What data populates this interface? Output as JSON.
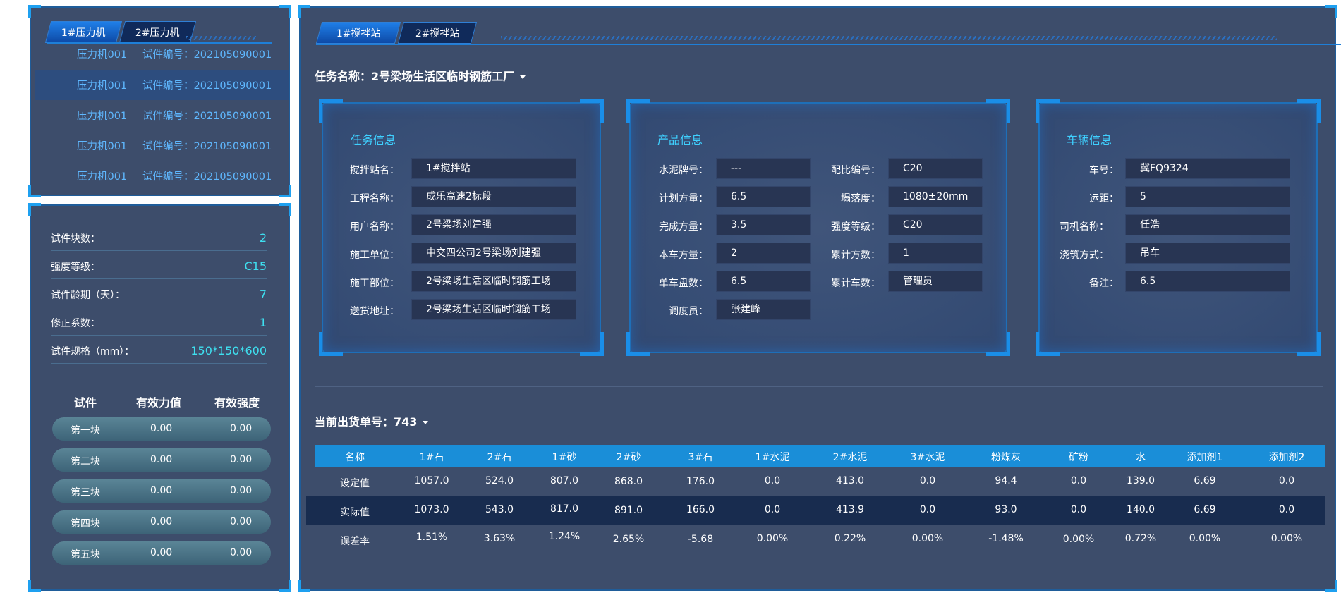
{
  "left_top": {
    "tabs": [
      "1#压力机",
      "2#压力机"
    ],
    "rows": [
      {
        "name": "压力机001",
        "code": "试件编号：202105090001"
      },
      {
        "name": "压力机001",
        "code": "试件编号：202105090001"
      },
      {
        "name": "压力机001",
        "code": "试件编号：202105090001"
      },
      {
        "name": "压力机001",
        "code": "试件编号：202105090001"
      },
      {
        "name": "压力机001",
        "code": "试件编号：202105090001"
      }
    ]
  },
  "left_bottom": {
    "stats": [
      {
        "label": "试件块数：",
        "value": "2"
      },
      {
        "label": "强度等级：",
        "value": "C15"
      },
      {
        "label": "试件龄期（天）：",
        "value": "7"
      },
      {
        "label": "修正系数：",
        "value": "1"
      },
      {
        "label": "试件规格（mm）：",
        "value": "150*150*600"
      }
    ],
    "table_headers": [
      "试件",
      "有效力值",
      "有效强度"
    ],
    "blocks": [
      {
        "name": "第一块",
        "force": "0.00",
        "strength": "0.00"
      },
      {
        "name": "第二块",
        "force": "0.00",
        "strength": "0.00"
      },
      {
        "name": "第三块",
        "force": "0.00",
        "strength": "0.00"
      },
      {
        "name": "第四块",
        "force": "0.00",
        "strength": "0.00"
      },
      {
        "name": "第五块",
        "force": "0.00",
        "strength": "0.00"
      }
    ]
  },
  "right": {
    "tabs": [
      "1#搅拌站",
      "2#搅拌站"
    ],
    "task_name": "任务名称：2号梁场生活区临时钢筋工厂",
    "task_info": {
      "title": "任务信息",
      "fields": [
        {
          "label": "搅拌站名：",
          "value": "1#搅拌站"
        },
        {
          "label": "工程名称：",
          "value": "成乐高速2标段"
        },
        {
          "label": "用户名称：",
          "value": "2号梁场刘建强"
        },
        {
          "label": "施工单位：",
          "value": "中交四公司2号梁场刘建强"
        },
        {
          "label": "施工部位：",
          "value": "2号梁场生活区临时钢筋工场"
        },
        {
          "label": "送货地址：",
          "value": "2号梁场生活区临时钢筋工场"
        }
      ]
    },
    "product_info": {
      "title": "产品信息",
      "left_fields": [
        {
          "label": "水泥牌号：",
          "value": "---"
        },
        {
          "label": "计划方量：",
          "value": "6.5"
        },
        {
          "label": "完成方量：",
          "value": "3.5"
        },
        {
          "label": "本车方量：",
          "value": "2"
        },
        {
          "label": "单车盘数：",
          "value": "6.5"
        },
        {
          "label": "调度员：",
          "value": "张建峰"
        }
      ],
      "right_fields": [
        {
          "label": "配比编号：",
          "value": "C20"
        },
        {
          "label": "塌落度：",
          "value": "1080±20mm"
        },
        {
          "label": "强度等级：",
          "value": "C20"
        },
        {
          "label": "累计方数：",
          "value": "1"
        },
        {
          "label": "累计车数：",
          "value": "管理员"
        }
      ]
    },
    "vehicle_info": {
      "title": "车辆信息",
      "fields": [
        {
          "label": "车号：",
          "value": "冀FQ9324"
        },
        {
          "label": "运距：",
          "value": "5"
        },
        {
          "label": "司机名称：",
          "value": "任浩"
        },
        {
          "label": "浇筑方式：",
          "value": "吊车"
        },
        {
          "label": "备注：",
          "value": "6.5"
        }
      ]
    },
    "shipment_no": "当前出货单号：743",
    "table": {
      "headers": [
        "名称",
        "1#石",
        "2#石",
        "1#砂",
        "2#砂",
        "3#石",
        "1#水泥",
        "2#水泥",
        "3#水泥",
        "粉煤灰",
        "矿粉",
        "水",
        "添加剂1",
        "添加剂2"
      ],
      "rows": [
        [
          "设定值",
          "1057.0",
          "524.0",
          "807.0",
          "868.0",
          "176.0",
          "0.0",
          "413.0",
          "0.0",
          "94.4",
          "0.0",
          "139.0",
          "6.69",
          "0.0"
        ],
        [
          "实际值",
          "1073.0",
          "543.0",
          "817.0",
          "891.0",
          "166.0",
          "0.0",
          "413.9",
          "0.0",
          "93.0",
          "0.0",
          "140.0",
          "6.69",
          "0.0"
        ],
        [
          "误差率",
          "1.51%",
          "3.63%",
          "1.24%",
          "2.65%",
          "-5.68",
          "0.00%",
          "0.22%",
          "0.00%",
          "-1.48%",
          "0.00%",
          "0.72%",
          "0.00%",
          "0.00%"
        ]
      ]
    }
  }
}
